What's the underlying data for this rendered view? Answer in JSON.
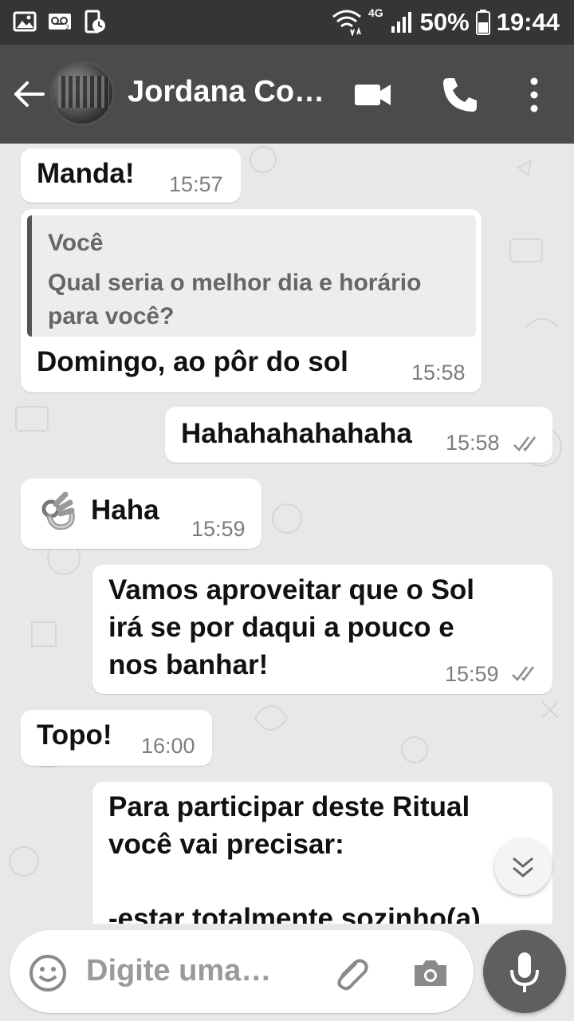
{
  "status_bar": {
    "network": "4G",
    "battery": "50%",
    "time": "19:44"
  },
  "header": {
    "contact_name": "Jordana Co…",
    "icons": [
      "back-arrow-icon",
      "video-call-icon",
      "phone-icon",
      "more-vert-icon"
    ]
  },
  "messages": [
    {
      "direction": "in",
      "text": "Manda!",
      "time": "15:57"
    },
    {
      "direction": "in",
      "quote_author": "Você",
      "quote_text": "Qual seria o melhor dia e horário para você?",
      "text": "Domingo, ao pôr do sol",
      "time": "15:58"
    },
    {
      "direction": "out",
      "text": "Hahahahahahaha",
      "time": "15:58",
      "status": "read"
    },
    {
      "direction": "in",
      "emoji": "ok-hand",
      "text": "Haha",
      "time": "15:59"
    },
    {
      "direction": "out",
      "text_lines": [
        "Vamos aproveitar que o Sol",
        "irá se por daqui a pouco e",
        "nos banhar!"
      ],
      "time": "15:59",
      "status": "read"
    },
    {
      "direction": "in",
      "text": "Topo!",
      "time": "16:00"
    },
    {
      "direction": "out",
      "text_lines": [
        "Para participar deste Ritual",
        "você vai precisar:",
        "",
        "-estar totalmente sozinho(a)"
      ]
    }
  ],
  "input": {
    "placeholder": "Digite uma…",
    "icons": [
      "emoji-icon",
      "attach-icon",
      "camera-icon",
      "mic-icon"
    ]
  },
  "colors": {
    "status_bar": "#353535",
    "app_bar": "#4b4b4b",
    "bubble": "#ffffff",
    "chat_bg": "#e8e8e8"
  }
}
